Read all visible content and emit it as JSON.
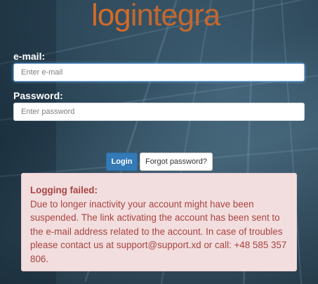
{
  "logo": {
    "part1": "log",
    "part2": "integra"
  },
  "email": {
    "label": "e-mail:",
    "placeholder": "Enter e-mail"
  },
  "password": {
    "label": "Password:",
    "placeholder": "Enter password"
  },
  "buttons": {
    "login": "Login",
    "forgot": "Forgot password?"
  },
  "alert": {
    "title": "Logging failed:",
    "message": "Due to longer inactivity your account might have been suspended. The link activating the account has been sent to the e-mail address related to the account. In case of troubles please contact us at support@support.xd or call: +48 585 357 806."
  },
  "colors": {
    "brand": "#d36a2a",
    "primary": "#337ab7",
    "alert_bg": "#f2dede",
    "alert_text": "#a94442"
  }
}
